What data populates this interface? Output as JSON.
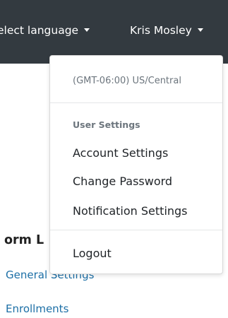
{
  "navbar": {
    "language_label": "elect language",
    "user_name": "Kris Mosley"
  },
  "dropdown": {
    "timezone": "(GMT-06:00) US/Central",
    "section_header": "User Settings",
    "items": [
      {
        "label": "Account Settings"
      },
      {
        "label": "Change Password"
      },
      {
        "label": "Notification Settings"
      }
    ],
    "logout_label": "Logout"
  },
  "content": {
    "heading": "orm L",
    "links": [
      {
        "label": "General Settings"
      },
      {
        "label": "Enrollments"
      }
    ]
  },
  "colors": {
    "navbar_bg": "#333a40",
    "link": "#1c6fa6",
    "muted_text": "#6c757d"
  }
}
